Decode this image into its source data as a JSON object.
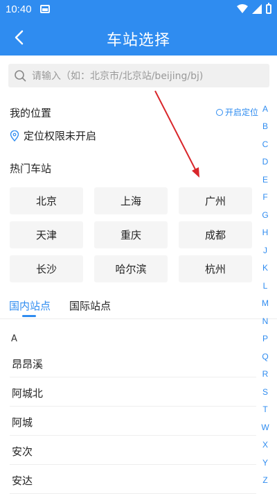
{
  "status_bar": {
    "time": "10:40"
  },
  "header": {
    "title": "车站选择"
  },
  "search": {
    "placeholder": "请输入（如：北京市/北京站/beijing/bj)"
  },
  "location": {
    "title": "我的位置",
    "enable_label": "开启定位",
    "status": "定位权限未开启"
  },
  "hot": {
    "title": "热门车站",
    "cities": [
      "北京",
      "上海",
      "广州",
      "天津",
      "重庆",
      "成都",
      "长沙",
      "哈尔滨",
      "杭州"
    ]
  },
  "tabs": [
    {
      "label": "国内站点",
      "active": true
    },
    {
      "label": "国际站点",
      "active": false
    }
  ],
  "list": {
    "section": "A",
    "stations": [
      "昂昂溪",
      "阿城北",
      "阿城",
      "安次",
      "安达"
    ]
  },
  "alphabet": [
    "A",
    "B",
    "C",
    "D",
    "E",
    "F",
    "G",
    "H",
    "J",
    "K",
    "L",
    "M",
    "N",
    "P",
    "Q",
    "R",
    "S",
    "T",
    "W",
    "X",
    "Y",
    "Z"
  ],
  "colors": {
    "accent": "#2f8cf0",
    "annotation": "#d9262b"
  }
}
